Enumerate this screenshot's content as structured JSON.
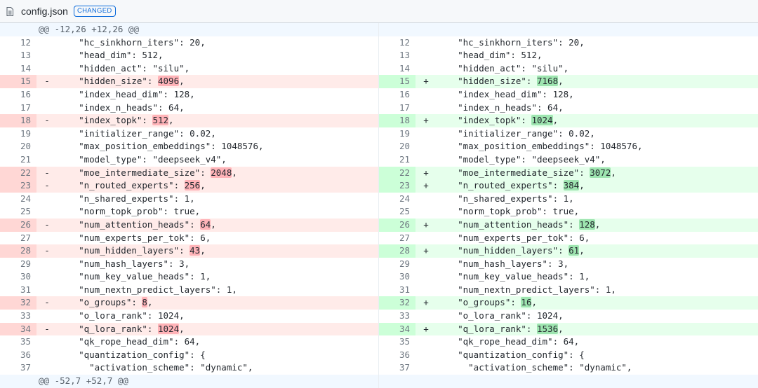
{
  "header": {
    "file_name": "config.json",
    "badge": "CHANGED",
    "icon": "file-icon"
  },
  "hunks": {
    "top": "@@ -12,26 +12,26 @@",
    "bottom": "@@ -52,7 +52,7 @@"
  },
  "lines": [
    {
      "n": "12",
      "type": "ctx",
      "pre": "    \"hc_sinkhorn_iters\": 20,",
      "old": "",
      "new": "",
      "post": ""
    },
    {
      "n": "13",
      "type": "ctx",
      "pre": "    \"head_dim\": 512,",
      "old": "",
      "new": "",
      "post": ""
    },
    {
      "n": "14",
      "type": "ctx",
      "pre": "    \"hidden_act\": \"silu\",",
      "old": "",
      "new": "",
      "post": ""
    },
    {
      "n": "15",
      "type": "chg",
      "pre": "    \"hidden_size\": ",
      "old": "4096",
      "new": "7168",
      "post": ","
    },
    {
      "n": "16",
      "type": "ctx",
      "pre": "    \"index_head_dim\": 128,",
      "old": "",
      "new": "",
      "post": ""
    },
    {
      "n": "17",
      "type": "ctx",
      "pre": "    \"index_n_heads\": 64,",
      "old": "",
      "new": "",
      "post": ""
    },
    {
      "n": "18",
      "type": "chg",
      "pre": "    \"index_topk\": ",
      "old": "512",
      "new": "1024",
      "post": ","
    },
    {
      "n": "19",
      "type": "ctx",
      "pre": "    \"initializer_range\": 0.02,",
      "old": "",
      "new": "",
      "post": ""
    },
    {
      "n": "20",
      "type": "ctx",
      "pre": "    \"max_position_embeddings\": 1048576,",
      "old": "",
      "new": "",
      "post": ""
    },
    {
      "n": "21",
      "type": "ctx",
      "pre": "    \"model_type\": \"deepseek_v4\",",
      "old": "",
      "new": "",
      "post": ""
    },
    {
      "n": "22",
      "type": "chg",
      "pre": "    \"moe_intermediate_size\": ",
      "old": "2048",
      "new": "3072",
      "post": ","
    },
    {
      "n": "23",
      "type": "chg",
      "pre": "    \"n_routed_experts\": ",
      "old": "256",
      "new": "384",
      "post": ","
    },
    {
      "n": "24",
      "type": "ctx",
      "pre": "    \"n_shared_experts\": 1,",
      "old": "",
      "new": "",
      "post": ""
    },
    {
      "n": "25",
      "type": "ctx",
      "pre": "    \"norm_topk_prob\": true,",
      "old": "",
      "new": "",
      "post": ""
    },
    {
      "n": "26",
      "type": "chg",
      "pre": "    \"num_attention_heads\": ",
      "old": "64",
      "new": "128",
      "post": ","
    },
    {
      "n": "27",
      "type": "ctx",
      "pre": "    \"num_experts_per_tok\": 6,",
      "old": "",
      "new": "",
      "post": ""
    },
    {
      "n": "28",
      "type": "chg",
      "pre": "    \"num_hidden_layers\": ",
      "old": "43",
      "new": "61",
      "post": ","
    },
    {
      "n": "29",
      "type": "ctx",
      "pre": "    \"num_hash_layers\": 3,",
      "old": "",
      "new": "",
      "post": ""
    },
    {
      "n": "30",
      "type": "ctx",
      "pre": "    \"num_key_value_heads\": 1,",
      "old": "",
      "new": "",
      "post": ""
    },
    {
      "n": "31",
      "type": "ctx",
      "pre": "    \"num_nextn_predict_layers\": 1,",
      "old": "",
      "new": "",
      "post": ""
    },
    {
      "n": "32",
      "type": "chg",
      "pre": "    \"o_groups\": ",
      "old": "8",
      "new": "16",
      "post": ","
    },
    {
      "n": "33",
      "type": "ctx",
      "pre": "    \"o_lora_rank\": 1024,",
      "old": "",
      "new": "",
      "post": ""
    },
    {
      "n": "34",
      "type": "chg",
      "pre": "    \"q_lora_rank\": ",
      "old": "1024",
      "new": "1536",
      "post": ","
    },
    {
      "n": "35",
      "type": "ctx",
      "pre": "    \"qk_rope_head_dim\": 64,",
      "old": "",
      "new": "",
      "post": ""
    },
    {
      "n": "36",
      "type": "ctx",
      "pre": "    \"quantization_config\": {",
      "old": "",
      "new": "",
      "post": ""
    },
    {
      "n": "37",
      "type": "ctx",
      "pre": "      \"activation_scheme\": \"dynamic\",",
      "old": "",
      "new": "",
      "post": ""
    }
  ],
  "signs": {
    "del": "-",
    "add": "+"
  },
  "colors": {
    "del_bg": "#ffebe9",
    "add_bg": "#e6ffec",
    "del_word": "#ffb3b8",
    "add_word": "#9ee5b0",
    "hunk_bg": "#ddf4ff",
    "badge": "#0969da"
  }
}
